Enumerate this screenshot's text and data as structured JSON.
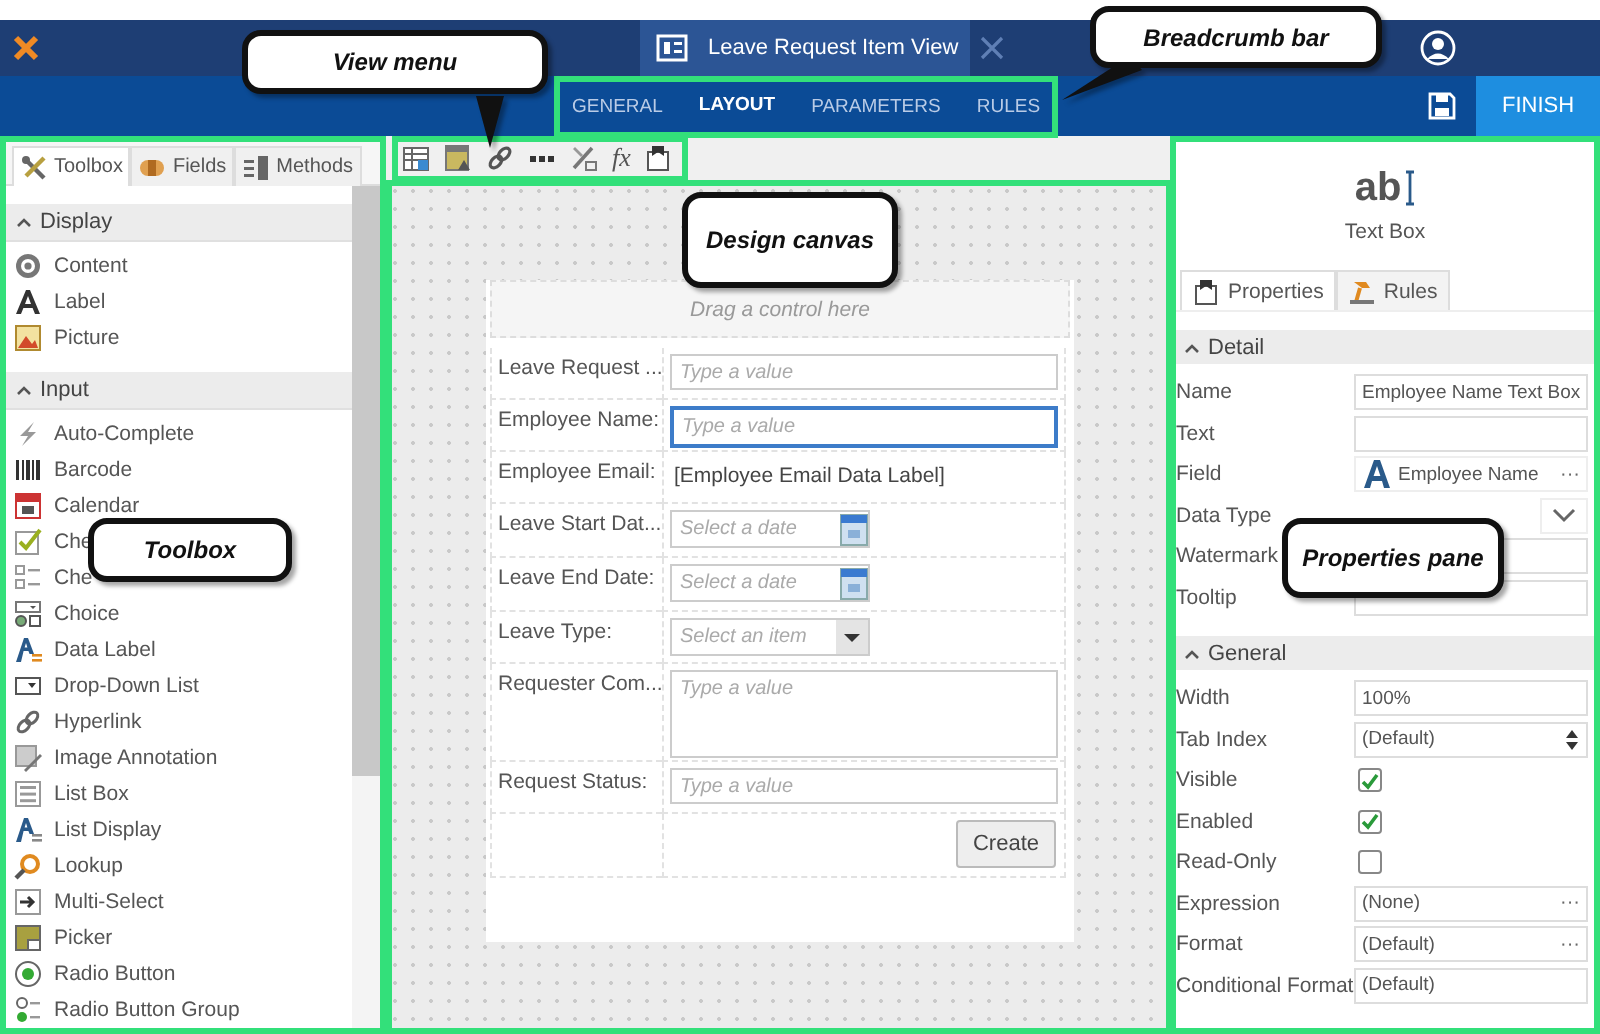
{
  "app_bar": {
    "document_title": "Leave Request Item View"
  },
  "nav_tabs": [
    {
      "label": "GENERAL",
      "selected": false
    },
    {
      "label": "LAYOUT",
      "selected": true
    },
    {
      "label": "PARAMETERS",
      "selected": false
    },
    {
      "label": "RULES",
      "selected": false
    }
  ],
  "finish_button": "FINISH",
  "toolbox": {
    "tabs": [
      {
        "label": "Toolbox",
        "selected": true
      },
      {
        "label": "Fields",
        "selected": false
      },
      {
        "label": "Methods",
        "selected": false
      }
    ],
    "sections": [
      {
        "title": "Display",
        "expanded": true,
        "items": [
          "Content",
          "Label",
          "Picture"
        ]
      },
      {
        "title": "Input",
        "expanded": true,
        "items": [
          "Auto-Complete",
          "Barcode",
          "Calendar",
          "Che",
          "Che",
          "Choice",
          "Data Label",
          "Drop-Down List",
          "Hyperlink",
          "Image Annotation",
          "List Box",
          "List Display",
          "Lookup",
          "Multi-Select",
          "Picker",
          "Radio Button",
          "Radio Button Group"
        ]
      }
    ]
  },
  "canvas": {
    "toolbar": {
      "formula_label": "fx"
    },
    "drop_hint": "Drag a control here",
    "rows": [
      {
        "label": "Leave Request ...",
        "kind": "textbox",
        "placeholder": "Type a value",
        "selected": false
      },
      {
        "label": "Employee Name:",
        "kind": "textbox",
        "placeholder": "Type a value",
        "selected": true
      },
      {
        "label": "Employee Email:",
        "kind": "data_label",
        "value": "[Employee Email Data Label]",
        "selected": false
      },
      {
        "label": "Leave Start Dat...",
        "kind": "date",
        "placeholder": "Select a date",
        "selected": false
      },
      {
        "label": "Leave End Date:",
        "kind": "date",
        "placeholder": "Select a date",
        "selected": false
      },
      {
        "label": "Leave Type:",
        "kind": "dropdown",
        "placeholder": "Select an item",
        "selected": false
      },
      {
        "label": "Requester Com...",
        "kind": "textarea",
        "placeholder": "Type a value",
        "selected": false
      },
      {
        "label": "Request Status:",
        "kind": "textbox",
        "placeholder": "Type a value",
        "selected": false
      }
    ],
    "button": "Create"
  },
  "properties": {
    "control_icon_text": "ab",
    "control_name": "Text Box",
    "tabs": [
      {
        "label": "Properties",
        "selected": true
      },
      {
        "label": "Rules",
        "selected": false
      }
    ],
    "sections": [
      {
        "title": "Detail",
        "items": [
          {
            "label": "Name",
            "kind": "text",
            "value": "Employee Name Text Box"
          },
          {
            "label": "Text",
            "kind": "text"
          },
          {
            "label": "Field",
            "kind": "field",
            "value": "Employee Name",
            "button": "···"
          },
          {
            "label": "Data Type",
            "kind": "select"
          },
          {
            "label": "Watermark",
            "kind": "text"
          },
          {
            "label": "Tooltip",
            "kind": "text"
          }
        ]
      },
      {
        "title": "General",
        "items": [
          {
            "label": "Width",
            "kind": "text",
            "value": "100%"
          },
          {
            "label": "Tab Index",
            "kind": "spinner",
            "value": "(Default)"
          },
          {
            "label": "Visible",
            "kind": "checkbox",
            "checked": true
          },
          {
            "label": "Enabled",
            "kind": "checkbox",
            "checked": true
          },
          {
            "label": "Read-Only",
            "kind": "checkbox",
            "checked": false
          },
          {
            "label": "Expression",
            "kind": "picker",
            "value": "(None)",
            "button": "···"
          },
          {
            "label": "Format",
            "kind": "picker",
            "value": "(Default)",
            "button": "···"
          },
          {
            "label": "Conditional Format",
            "kind": "picker",
            "value": "(Default)"
          }
        ]
      }
    ]
  },
  "annotations": [
    {
      "text": "View menu"
    },
    {
      "text": "Breadcrumb bar"
    },
    {
      "text": "Design canvas"
    },
    {
      "text": "Toolbox"
    },
    {
      "text": "Properties pane"
    }
  ]
}
